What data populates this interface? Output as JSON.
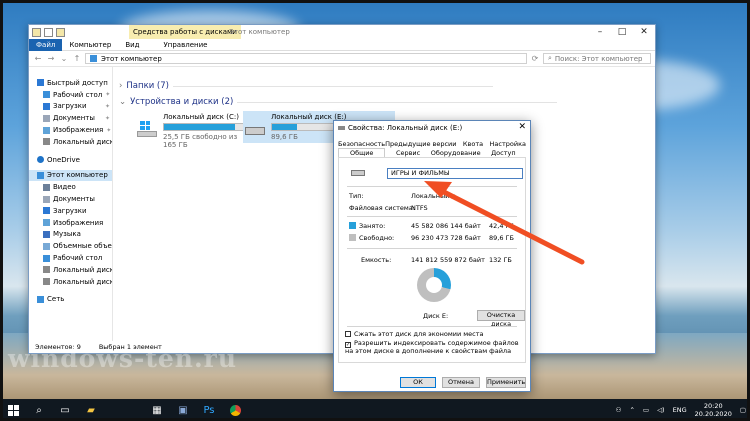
{
  "explorer": {
    "window_title": "Этот компьютер",
    "contextual_tab": "Средства работы с дисками",
    "ribbon_tabs": [
      "Файл",
      "Компьютер",
      "Вид",
      "Управление"
    ],
    "address": "Этот компьютер",
    "search_placeholder": "Поиск: Этот компьютер",
    "nav": {
      "quick_access": "Быстрый доступ",
      "quick_items": [
        "Рабочий стол",
        "Загрузки",
        "Документы",
        "Изображения",
        "Локальный диск"
      ],
      "onedrive": "OneDrive",
      "this_pc": "Этот компьютер",
      "pc_items": [
        "Видео",
        "Документы",
        "Загрузки",
        "Изображения",
        "Музыка",
        "Объемные объекты",
        "Рабочий стол",
        "Локальный диск (C",
        "Локальный диск (E"
      ],
      "network": "Сеть"
    },
    "groups": {
      "folders": "Папки (7)",
      "devices": "Устройства и диски (2)"
    },
    "drives": [
      {
        "name": "Локальный диск (C:)",
        "free": "25,5 ГБ свободно из 165 ГБ",
        "used_fraction": 0.85
      },
      {
        "name": "Локальный диск (E:)",
        "free": "89,6 ГБ",
        "used_fraction": 0.3
      }
    ],
    "status": {
      "items": "Элементов: 9",
      "selected": "Выбран 1 элемент"
    }
  },
  "dialog": {
    "title": "Свойства: Локальный диск (E:)",
    "tabs_row1": [
      "Безопасность",
      "Предыдущие версии",
      "Квота",
      "Настройка"
    ],
    "tabs_row2": [
      "Общие",
      "Сервис",
      "Оборудование",
      "Доступ"
    ],
    "name_value": "ИГРЫ И ФИЛЬМЫ",
    "type_label": "Тип:",
    "type_value": "Локальный д",
    "fs_label": "Файловая система:",
    "fs_value": "NTFS",
    "used_label": "Занято:",
    "used_bytes": "45 582 086 144 байт",
    "used_gb": "42,4 ГБ",
    "free_label": "Свободно:",
    "free_bytes": "96 230 473 728 байт",
    "free_gb": "89,6 ГБ",
    "capacity_label": "Емкость:",
    "capacity_bytes": "141 812 559 872 байт",
    "capacity_gb": "132 ГБ",
    "disk_label": "Диск E:",
    "cleanup": "Очистка диска",
    "compress": "Сжать этот диск для экономии места",
    "index": "Разрешить индексировать содержимое файлов на этом диске в дополнение к свойствам файла",
    "ok": "ОК",
    "cancel": "Отмена",
    "apply": "Применить",
    "used_fraction": 0.29
  },
  "taskbar": {
    "lang": "ENG",
    "time": "20:20",
    "date": "20.20.2020"
  },
  "watermark": "windows-ten.ru",
  "colors": {
    "accent": "#26a0da",
    "arrow": "#f04e23",
    "file_tab": "#1a63b0"
  }
}
